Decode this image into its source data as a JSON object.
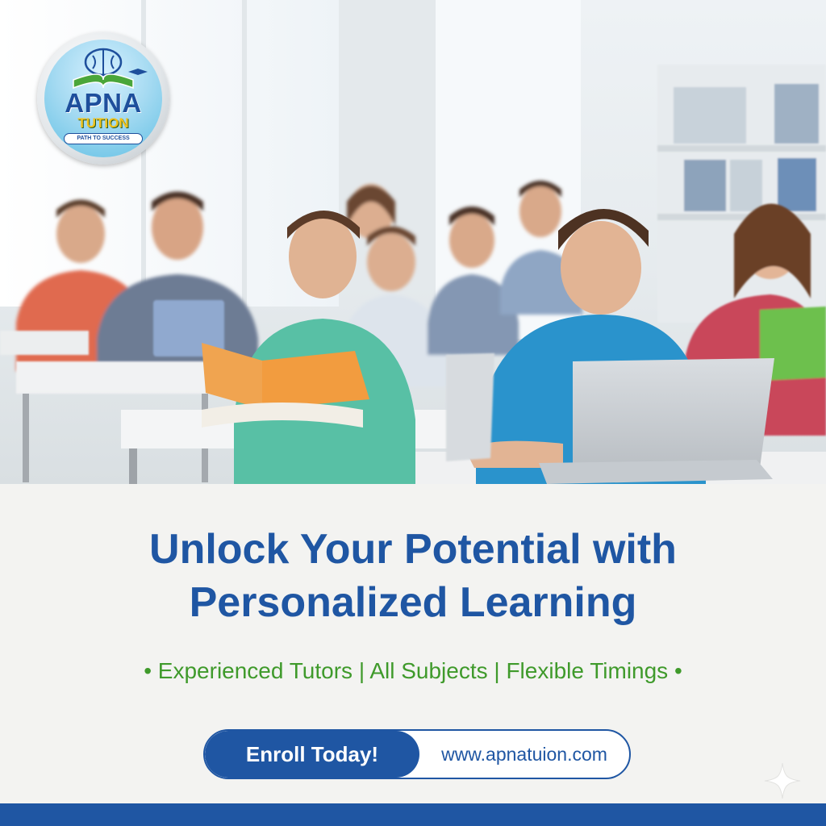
{
  "logo": {
    "brand_line1": "APNA",
    "brand_line2": "TUTION",
    "tagline": "PATH TO SUCCESS"
  },
  "hero": {
    "headline_line1": "Unlock Your Potential with",
    "headline_line2": "Personalized Learning",
    "features": "• Experienced Tutors | All Subjects | Flexible Timings •"
  },
  "cta": {
    "button_label": "Enroll Today!",
    "website": "www.apnatuion.com"
  },
  "colors": {
    "brand_blue": "#1f56a3",
    "feature_green": "#3f9a2b",
    "panel_background": "#f3f3f1"
  },
  "icons": {
    "logo_emblem": "brain-book-icon",
    "corner_mark": "sparkle-icon"
  }
}
